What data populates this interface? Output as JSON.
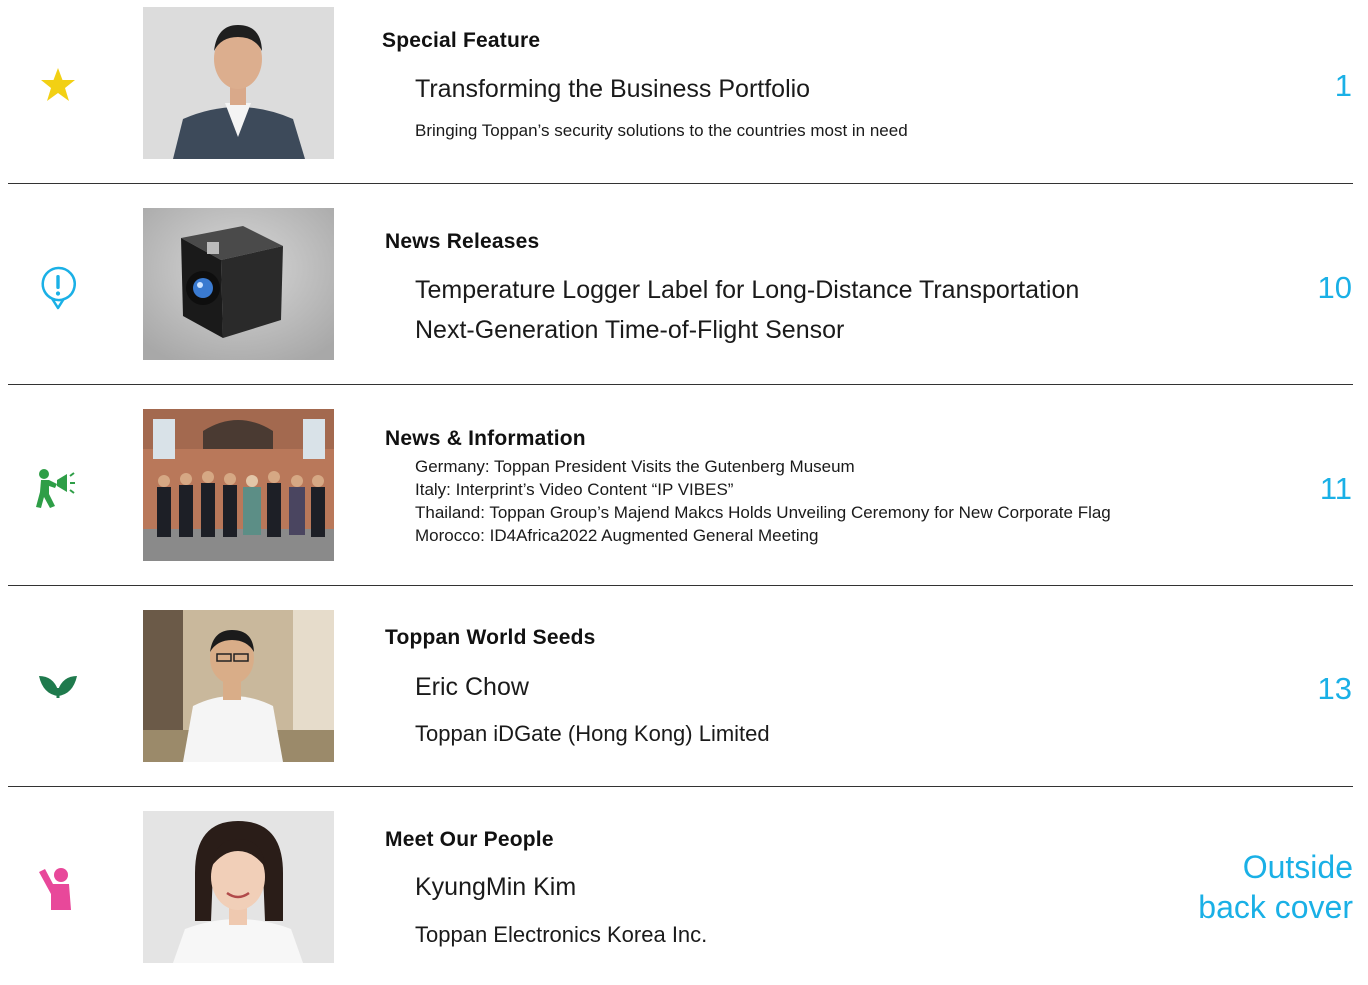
{
  "colors": {
    "accent": "#1ab0e6",
    "star_icon": "#f2d014",
    "alert_icon": "#1ab0e6",
    "megaphone_icon": "#2e9e47",
    "sprout_icon": "#1f7a4d",
    "person_icon": "#e8489a",
    "divider": "#333333"
  },
  "sections": [
    {
      "icon": "star-icon",
      "heading": "Special Feature",
      "title": "Transforming the Business Portfolio",
      "subtitle": "Bringing Toppan’s security solutions to the countries most in need",
      "page": "1"
    },
    {
      "icon": "alert-bubble-icon",
      "heading": "News Releases",
      "titles": [
        "Temperature Logger Label for Long-Distance Transportation",
        "Next-Generation Time-of-Flight Sensor"
      ],
      "page": "10"
    },
    {
      "icon": "megaphone-person-icon",
      "heading": "News & Information",
      "items": [
        "Germany: Toppan President Visits the Gutenberg Museum",
        "Italy: Interprint’s Video Content “IP VIBES”",
        "Thailand: Toppan Group’s Majend Makcs Holds Unveiling Ceremony for New Corporate Flag",
        "Morocco: ID4Africa2022 Augmented General Meeting"
      ],
      "page": "11"
    },
    {
      "icon": "sprout-icon",
      "heading": "Toppan World Seeds",
      "title": "Eric Chow",
      "subtitle": "Toppan iDGate (Hong Kong) Limited",
      "page": "13"
    },
    {
      "icon": "person-waving-icon",
      "heading": "Meet Our People",
      "title": "KyungMin Kim",
      "subtitle": "Toppan Electronics Korea Inc.",
      "page_lines": [
        "Outside",
        "back cover"
      ]
    }
  ]
}
